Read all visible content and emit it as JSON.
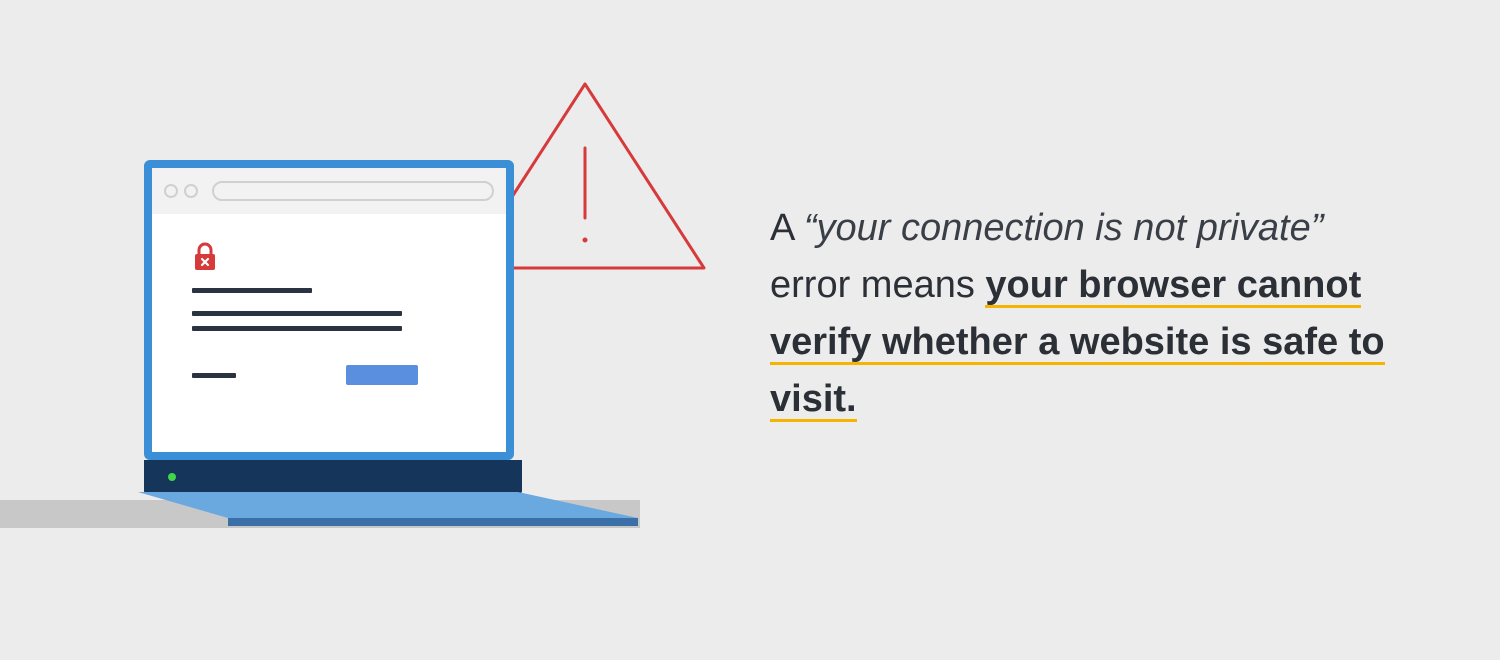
{
  "copy": {
    "prefix": "A ",
    "quoted": "“your connection is not private”",
    "mid": " error means ",
    "emphasis": "your browser cannot verify whether a website is safe to visit."
  },
  "icons": {
    "warning": "warning-triangle-icon",
    "lock": "lock-error-icon",
    "led": "power-led-icon"
  },
  "colors": {
    "bg": "#ececec",
    "frame": "#3a8fd6",
    "accent": "#f6b400",
    "danger": "#d63a3a",
    "ink": "#2b2f36"
  },
  "illustration": {
    "browser": {
      "window_controls": 2,
      "text_lines": 4,
      "has_button": true,
      "has_lock_error": true
    }
  }
}
